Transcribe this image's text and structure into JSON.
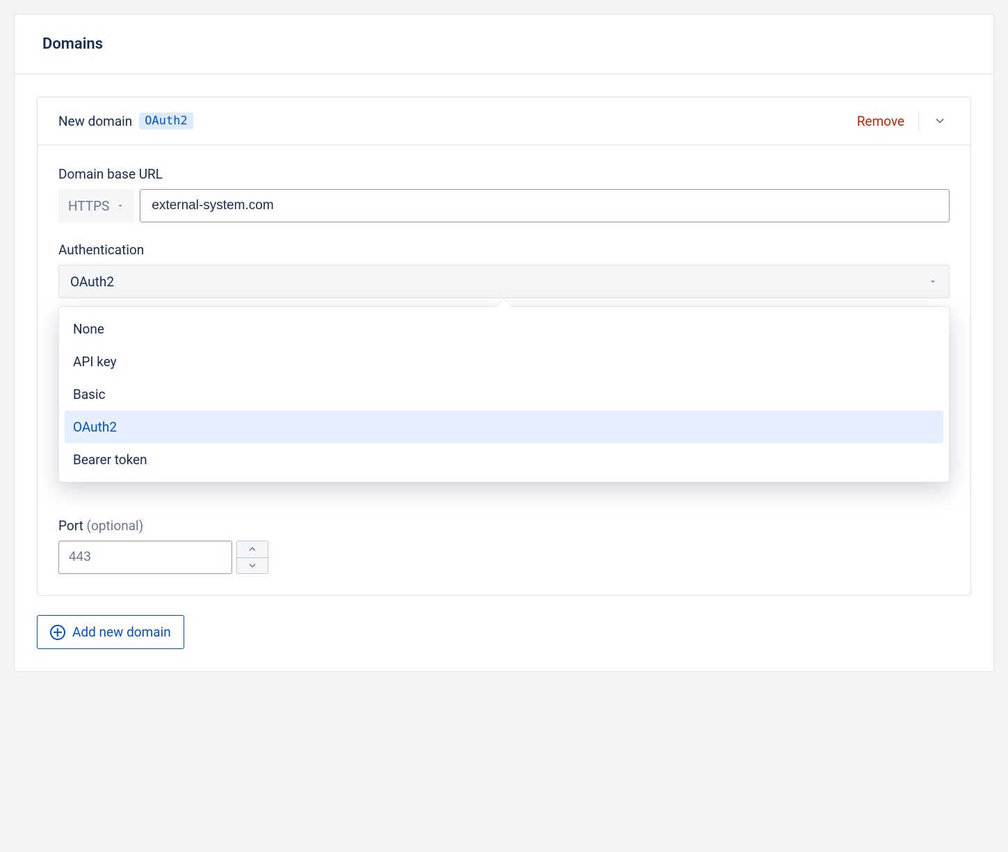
{
  "page": {
    "title": "Domains"
  },
  "domain": {
    "title": "New domain",
    "badge": "OAuth2",
    "remove_label": "Remove"
  },
  "fields": {
    "base_url_label": "Domain base URL",
    "protocol": "HTTPS",
    "base_url_value": "external-system.com",
    "auth_label": "Authentication",
    "auth_selected": "OAuth2",
    "port_label": "Port",
    "port_optional": "(optional)",
    "port_value": "443"
  },
  "auth_options": [
    {
      "label": "None",
      "selected": false
    },
    {
      "label": "API key",
      "selected": false
    },
    {
      "label": "Basic",
      "selected": false
    },
    {
      "label": "OAuth2",
      "selected": true
    },
    {
      "label": "Bearer token",
      "selected": false
    }
  ],
  "actions": {
    "add_domain": "Add new domain"
  },
  "colors": {
    "brand": "#0052cc",
    "danger": "#bf2600",
    "text": "#172b4d",
    "muted": "#6b778c",
    "highlight_bg": "#e6efff"
  }
}
